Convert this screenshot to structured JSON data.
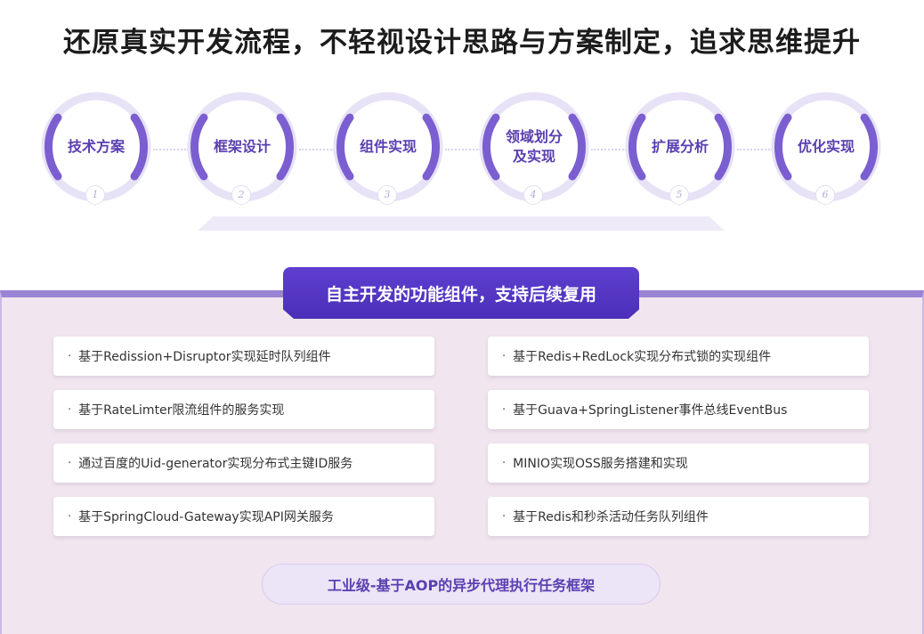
{
  "title": "还原真实开发流程，不轻视设计思路与方案制定，追求思维提升",
  "steps": [
    {
      "label": "技术方案",
      "num": "1"
    },
    {
      "label": "框架设计",
      "num": "2"
    },
    {
      "label": "组件实现",
      "num": "3"
    },
    {
      "label": "领域划分及实现",
      "num": "4"
    },
    {
      "label": "扩展分析",
      "num": "5"
    },
    {
      "label": "优化实现",
      "num": "6"
    }
  ],
  "panel": {
    "heading": "自主开发的功能组件，支持后续复用",
    "bullet": "·",
    "left_items": [
      "基于Redission+Disruptor实现延时队列组件",
      "基于RateLimter限流组件的服务实现",
      "通过百度的Uid-generator实现分布式主键ID服务",
      "基于SpringCloud-Gateway实现API网关服务"
    ],
    "right_items": [
      "基于Redis+RedLock实现分布式锁的实现组件",
      "基于Guava+SpringListener事件总线EventBus",
      "MINIO实现OSS服务搭建和实现",
      "基于Redis和秒杀活动任务队列组件"
    ],
    "footer": "工业级-基于AOP的异步代理执行任务框架"
  },
  "colors": {
    "accent": "#5a3fb0",
    "ring": "#7b5fd1",
    "ring_light": "#e7e2f6",
    "panel_bg": "#f1e6ef"
  }
}
